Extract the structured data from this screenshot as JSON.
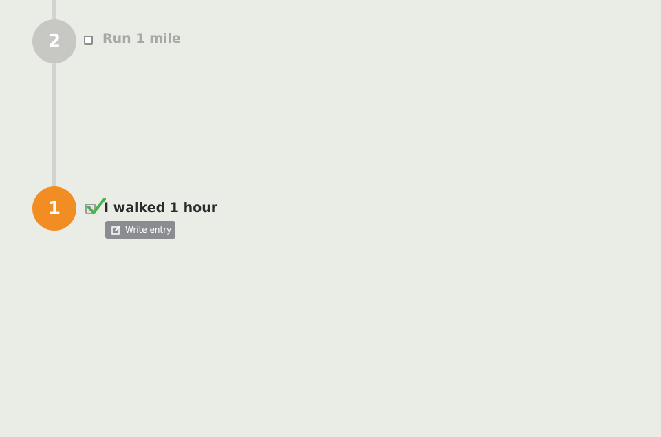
{
  "timeline": {
    "steps": [
      {
        "number": "2",
        "goal": "Run 1 mile",
        "completed": false,
        "color": "#c7c7c4"
      },
      {
        "number": "1",
        "goal": "I walked 1 hour",
        "completed": true,
        "color": "#f28d24",
        "action_label": "Write entry",
        "action_icon": "edit-icon"
      }
    ]
  },
  "colors": {
    "background": "#eaece6",
    "accent": "#f28d24",
    "check": "#4caf50"
  }
}
